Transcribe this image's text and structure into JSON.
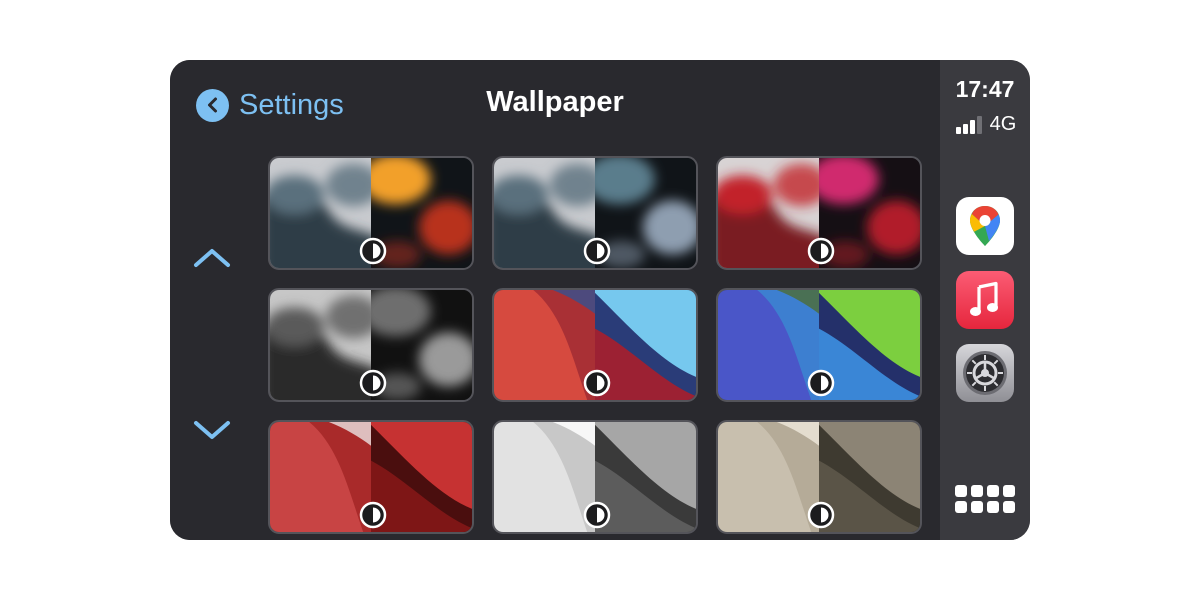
{
  "header": {
    "back_label": "Settings",
    "title": "Wallpaper"
  },
  "navigation": {
    "up_icon": "chevron-up-icon",
    "down_icon": "chevron-down-icon"
  },
  "status": {
    "time": "17:47",
    "network": "4G",
    "signal_bars_filled": 3,
    "signal_bars_total": 4
  },
  "dock": {
    "apps": [
      {
        "name": "Google Maps",
        "icon": "maps-pin-icon"
      },
      {
        "name": "Music",
        "icon": "music-note-icon"
      },
      {
        "name": "Settings",
        "icon": "gear-icon"
      }
    ],
    "app_grid_icon": "app-grid-icon"
  },
  "wallpapers": [
    {
      "style": "blob",
      "light": [
        "#c9cbcf",
        "#5a6f7d",
        "#2e3d47"
      ],
      "dark": [
        "#101418",
        "#f2a02a",
        "#b8301f"
      ]
    },
    {
      "style": "blob",
      "light": [
        "#c9cbcf",
        "#5a6f7d",
        "#2e3d47"
      ],
      "dark": [
        "#101418",
        "#5a7d8c",
        "#8e9eb0"
      ]
    },
    {
      "style": "blob",
      "light": [
        "#d8d3d4",
        "#c2242b",
        "#7a1a22"
      ],
      "dark": [
        "#150f14",
        "#d02a6e",
        "#b11f2a"
      ]
    },
    {
      "style": "blob",
      "light": [
        "#c7c7c7",
        "#5a5a5a",
        "#2c2c2c"
      ],
      "dark": [
        "#111111",
        "#6e6e6e",
        "#9a9a9a"
      ]
    },
    {
      "style": "wave",
      "light": [
        "#d64a3f",
        "#3d4f8a",
        "#a93035"
      ],
      "dark": [
        "#2a3c78",
        "#76c8ee",
        "#9c2133"
      ]
    },
    {
      "style": "wave",
      "light": [
        "#4a56c8",
        "#4c6d3e",
        "#3d7fd0"
      ],
      "dark": [
        "#24306a",
        "#7ccf3f",
        "#3a86d6"
      ]
    },
    {
      "style": "wave",
      "light": [
        "#c84444",
        "#e8d8d8",
        "#a92a2a"
      ],
      "dark": [
        "#4a0e0e",
        "#c63232",
        "#7e1616"
      ]
    },
    {
      "style": "wave",
      "light": [
        "#e2e2e2",
        "#ffffff",
        "#c8c8c8"
      ],
      "dark": [
        "#3a3a3a",
        "#a6a6a6",
        "#5c5c5c"
      ]
    },
    {
      "style": "wave",
      "light": [
        "#c8bfae",
        "#ece5d8",
        "#b5ab98"
      ],
      "dark": [
        "#3e3a30",
        "#8c8475",
        "#5a5447"
      ]
    }
  ]
}
